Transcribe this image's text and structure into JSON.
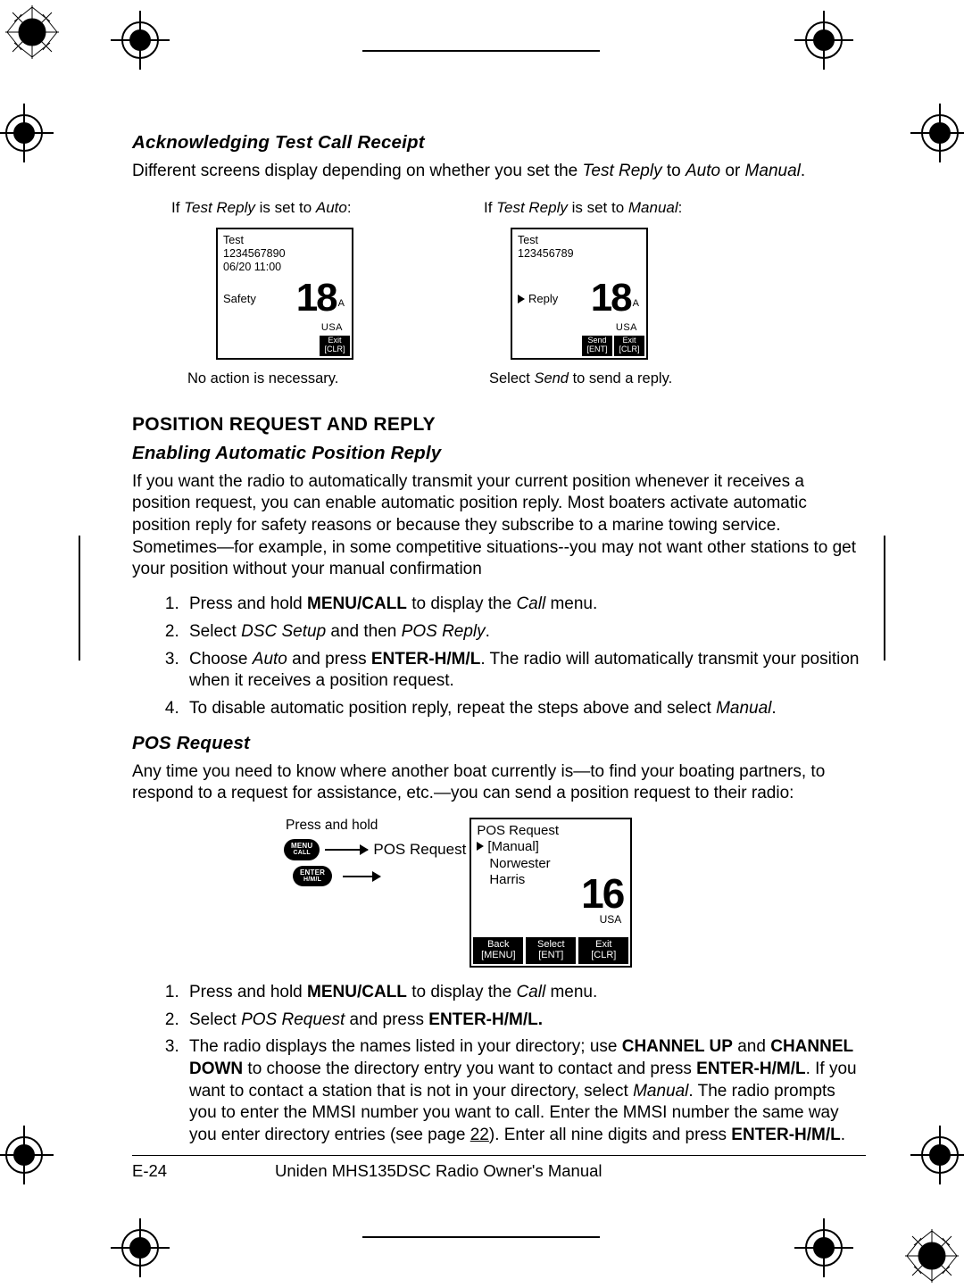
{
  "heading_ack": "Acknowledging Test Call Receipt",
  "ack_para_a": "Different screens display depending on whether you set the ",
  "ack_para_b": "Test Reply",
  "ack_para_c": " to ",
  "ack_para_d": "Auto",
  "ack_para_e": " or ",
  "ack_para_f": "Manual",
  "ack_para_g": ".",
  "fig1_caption_a": "If ",
  "fig1_caption_b": "Test Reply",
  "fig1_caption_c": " is set to ",
  "fig1_caption_d": "Auto",
  "fig1_caption_e": ":",
  "fig2_caption_a": "If ",
  "fig2_caption_b": "Test Reply",
  "fig2_caption_c": " is set to ",
  "fig2_caption_d": "Manual",
  "fig2_caption_e": ":",
  "lcd1": {
    "line1": "Test",
    "line2": "1234567890",
    "line3": "06/20  11:00",
    "left_label": "Safety",
    "ch": "18",
    "ch_sub": "A",
    "region": "USA",
    "soft1_a": "Exit",
    "soft1_b": "[CLR]"
  },
  "lcd2": {
    "line1": "Test",
    "line2": "123456789",
    "left_label": "Reply",
    "ch": "18",
    "ch_sub": "A",
    "region": "USA",
    "softL_a": "Send",
    "softL_b": "[ENT]",
    "softR_a": "Exit",
    "softR_b": "[CLR]"
  },
  "fig1_note": "No action is necessary.",
  "fig2_note_a": "Select ",
  "fig2_note_b": "Send",
  "fig2_note_c": " to send a reply.",
  "section_posreq_reply": "POSITION REQUEST AND REPLY",
  "heading_enable": "Enabling Automatic Position Reply",
  "enable_para": "If you want the radio to automatically transmit your current position whenever it receives a position request, you can enable automatic position reply. Most boaters activate automatic position reply for safety reasons or because they subscribe to a marine towing service. Sometimes—for example, in some competitive situations--you may not want other stations to get your position without your manual confirmation",
  "enable_step1_a": "Press and hold ",
  "enable_step1_b": "MENU/CALL",
  "enable_step1_c": " to display the ",
  "enable_step1_d": "Call",
  "enable_step1_e": " menu.",
  "enable_step2_a": "Select ",
  "enable_step2_b": "DSC Setup",
  "enable_step2_c": " and then ",
  "enable_step2_d": "POS Reply",
  "enable_step2_e": ".",
  "enable_step3_a": "Choose ",
  "enable_step3_b": "Auto",
  "enable_step3_c": " and press ",
  "enable_step3_d": "ENTER-H/M/L",
  "enable_step3_e": ". The radio will automatically transmit your position when it receives a position request.",
  "enable_step4_a": "To disable automatic position reply, repeat the steps above and select ",
  "enable_step4_b": "Manual",
  "enable_step4_c": ".",
  "heading_posreq": "POS Request",
  "posreq_para": "Any time you need to know where another boat currently is—to find your boating partners, to respond to a request for assistance, etc.—you can send a position request to their radio:",
  "posreq_fig": {
    "press_hold": "Press and hold",
    "btn_menu_a": "MENU",
    "btn_menu_b": "CALL",
    "arrow_label": "POS Request",
    "btn_enter_a": "ENTER",
    "btn_enter_b": "H/M/L"
  },
  "lcd3": {
    "line1": "POS Request",
    "line2": "[Manual]",
    "line3": "Norwester",
    "line4": "Harris",
    "ch": "16",
    "region": "USA",
    "soft1_a": "Back",
    "soft1_b": "[MENU]",
    "soft2_a": "Select",
    "soft2_b": "[ENT]",
    "soft3_a": "Exit",
    "soft3_b": "[CLR]"
  },
  "posreq_step1_a": "Press and hold ",
  "posreq_step1_b": "MENU/CALL",
  "posreq_step1_c": " to display the ",
  "posreq_step1_d": "Call",
  "posreq_step1_e": " menu.",
  "posreq_step2_a": "Select ",
  "posreq_step2_b": "POS Request",
  "posreq_step2_c": " and press ",
  "posreq_step2_d": "ENTER-H/M/L.",
  "posreq_step3_a": "The radio displays the names listed in your directory; use ",
  "posreq_step3_b": "CHANNEL UP",
  "posreq_step3_c": " and ",
  "posreq_step3_d": "CHANNEL DOWN",
  "posreq_step3_e": "  to choose the directory entry you want to contact and press ",
  "posreq_step3_f": "ENTER-H/M/L",
  "posreq_step3_g": ". If you want to contact a station that is not in your directory, select ",
  "posreq_step3_h": "Manual",
  "posreq_step3_i": ". The radio prompts you to enter the MMSI number you want to call. Enter the MMSI number the same way you enter directory entries (see page ",
  "posreq_step3_j": "22",
  "posreq_step3_k": "). Enter all nine digits and press ",
  "posreq_step3_l": "ENTER-H/M/L",
  "posreq_step3_m": ".",
  "footer_page": "E-24",
  "footer_title": "Uniden MHS135DSC Radio Owner's Manual"
}
